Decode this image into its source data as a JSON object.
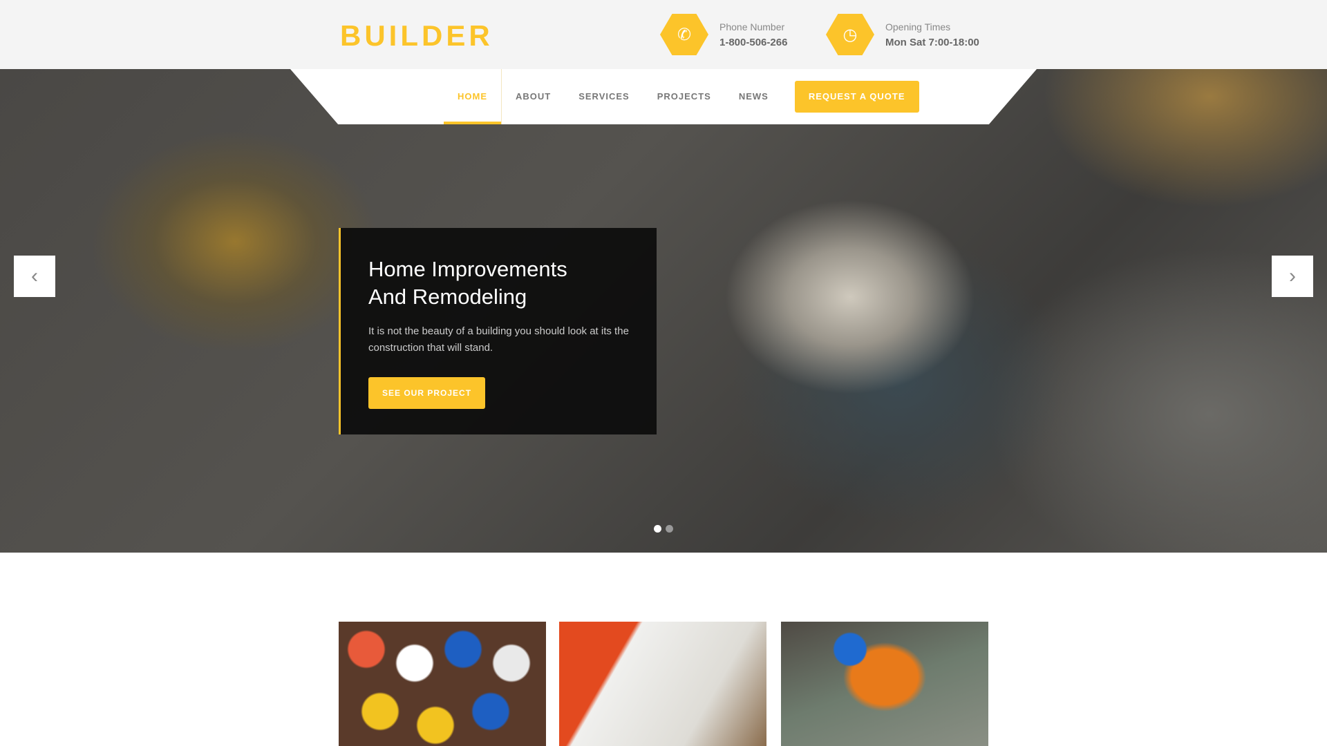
{
  "brand": {
    "logo": "BUILDER",
    "accent": "#fcc42a"
  },
  "contact": [
    {
      "icon": "phone-icon",
      "label": "Phone Number",
      "value": "1-800-506-266"
    },
    {
      "icon": "clock-icon",
      "label": "Opening Times",
      "value": "Mon Sat 7:00-18:00"
    }
  ],
  "nav": {
    "items": [
      "HOME",
      "ABOUT",
      "SERVICES",
      "PROJECTS",
      "NEWS"
    ],
    "active": "HOME",
    "cta": "REQUEST A QUOTE"
  },
  "hero": {
    "title_line1": "Home Improvements",
    "title_line2": "And Remodeling",
    "text": "It is not the beauty of a building you should look at its the construction that will stand.",
    "button": "SEE OUR PROJECT",
    "slide_current": 1,
    "slide_count": 2,
    "prev": "‹",
    "next": "›"
  }
}
